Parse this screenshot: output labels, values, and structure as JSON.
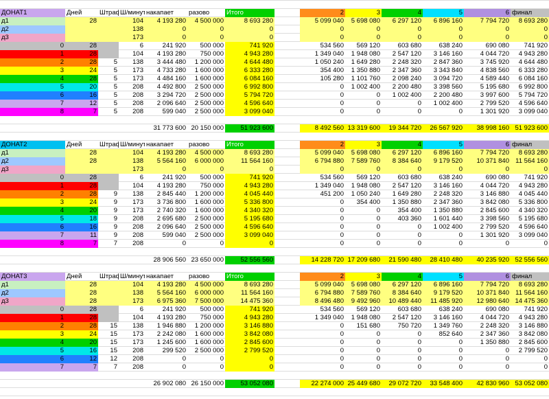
{
  "colors": {
    "lav": "#c9a6ee",
    "cyan": "#00c0f0",
    "lgreen": "#c8f0c0",
    "lblue": "#9ec8ff",
    "pink": "#f0a6c8",
    "ylw": "#ffff80",
    "gray": "#c0c0c0",
    "red": "#ff0000",
    "orange": "#ff8000",
    "yel": "#ffff00",
    "green": "#00d000",
    "cyn": "#00e8e8",
    "blue": "#2080ff",
    "mag": "#ff00ff",
    "total": "#ffff00",
    "itogo": "#00d000",
    "h2": "#ff8c1a",
    "h3": "#ffff00",
    "h4": "#00d000",
    "h5": "#00e0ff",
    "h6": "#b090e0",
    "hfin": "#c0c0c0"
  },
  "blocks": [
    {
      "header": [
        "ДОНАТ1",
        "Дней",
        "Штраф",
        "Ш/минут",
        "накапает",
        "разово",
        "Итого"
      ],
      "d_rows": [
        {
          "label": "д1",
          "days": "28",
          "fine": "",
          "sh": "104",
          "nak": "4 193 280",
          "raz": "4 500 000",
          "itogo": "8 693 280",
          "vals": [
            "5 099 040",
            "5 698 080",
            "6 297 120",
            "6 896 160",
            "7 794 720",
            "8 693 280"
          ]
        },
        {
          "label": "д2",
          "days": "",
          "fine": "",
          "sh": "138",
          "nak": "0",
          "raz": "0",
          "itogo": "0",
          "vals": [
            "0",
            "0",
            "0",
            "0",
            "0",
            "0"
          ]
        },
        {
          "label": "д3",
          "days": "",
          "fine": "",
          "sh": "173",
          "nak": "0",
          "raz": "0",
          "itogo": "0",
          "vals": [
            "0",
            "0",
            "0",
            "0",
            "0",
            "0"
          ]
        }
      ],
      "n_rows": [
        {
          "num": "0",
          "days": "28",
          "fine": "",
          "sh": "6",
          "nak": "241 920",
          "raz": "500 000",
          "itogo": "741 920",
          "vals": [
            "534 560",
            "569 120",
            "603 680",
            "638 240",
            "690 080",
            "741 920"
          ]
        },
        {
          "num": "1",
          "days": "28",
          "fine": "",
          "sh": "104",
          "nak": "4 193 280",
          "raz": "750 000",
          "itogo": "4 943 280",
          "vals": [
            "1 349 040",
            "1 948 080",
            "2 547 120",
            "3 146 160",
            "4 044 720",
            "4 943 280"
          ]
        },
        {
          "num": "2",
          "days": "28",
          "fine": "5",
          "sh": "138",
          "nak": "3 444 480",
          "raz": "1 200 000",
          "itogo": "4 644 480",
          "vals": [
            "1 050 240",
            "1 649 280",
            "2 248 320",
            "2 847 360",
            "3 745 920",
            "4 644 480"
          ]
        },
        {
          "num": "3",
          "days": "24",
          "fine": "5",
          "sh": "173",
          "nak": "4 733 280",
          "raz": "1 600 000",
          "itogo": "6 333 280",
          "vals": [
            "354 400",
            "1 350 880",
            "2 347 360",
            "3 343 840",
            "4 838 560",
            "6 333 280"
          ]
        },
        {
          "num": "4",
          "days": "28",
          "fine": "5",
          "sh": "173",
          "nak": "4 484 160",
          "raz": "1 600 000",
          "itogo": "6 084 160",
          "vals": [
            "105 280",
            "1 101 760",
            "2 098 240",
            "3 094 720",
            "4 589 440",
            "6 084 160"
          ]
        },
        {
          "num": "5",
          "days": "20",
          "fine": "5",
          "sh": "208",
          "nak": "4 492 800",
          "raz": "2 500 000",
          "itogo": "6 992 800",
          "vals": [
            "0",
            "1 002 400",
            "2 200 480",
            "3 398 560",
            "5 195 680",
            "6 992 800"
          ]
        },
        {
          "num": "6",
          "days": "16",
          "fine": "5",
          "sh": "208",
          "nak": "3 294 720",
          "raz": "2 500 000",
          "itogo": "5 794 720",
          "vals": [
            "0",
            "0",
            "1 002 400",
            "2 200 480",
            "3 997 600",
            "5 794 720"
          ]
        },
        {
          "num": "7",
          "days": "12",
          "fine": "5",
          "sh": "208",
          "nak": "2 096 640",
          "raz": "2 500 000",
          "itogo": "4 596 640",
          "vals": [
            "0",
            "0",
            "0",
            "1 002 400",
            "2 799 520",
            "4 596 640"
          ]
        },
        {
          "num": "8",
          "days": "7",
          "fine": "5",
          "sh": "208",
          "nak": "599 040",
          "raz": "2 500 000",
          "itogo": "3 099 040",
          "vals": [
            "0",
            "0",
            "0",
            "0",
            "1 301 920",
            "3 099 040"
          ]
        }
      ],
      "totals": {
        "nak": "31 773 600",
        "raz": "20 150 000",
        "itogo": "51 923 600",
        "vals": [
          "8 492 560",
          "13 319 600",
          "19 344 720",
          "26 567 920",
          "38 998 160",
          "51 923 600"
        ]
      }
    },
    {
      "header": [
        "ДОНАТ2",
        "Дней",
        "Штраф",
        "Ш/минут",
        "накапает",
        "разово",
        "Итого"
      ],
      "d_rows": [
        {
          "label": "д1",
          "days": "28",
          "fine": "",
          "sh": "104",
          "nak": "4 193 280",
          "raz": "4 500 000",
          "itogo": "8 693 280",
          "vals": [
            "5 099 040",
            "5 698 080",
            "6 297 120",
            "6 896 160",
            "7 794 720",
            "8 693 280"
          ]
        },
        {
          "label": "д2",
          "days": "28",
          "fine": "",
          "sh": "138",
          "nak": "5 564 160",
          "raz": "6 000 000",
          "itogo": "11 564 160",
          "vals": [
            "6 794 880",
            "7 589 760",
            "8 384 640",
            "9 179 520",
            "10 371 840",
            "11 564 160"
          ]
        },
        {
          "label": "д3",
          "days": "",
          "fine": "",
          "sh": "173",
          "nak": "0",
          "raz": "0",
          "itogo": "0",
          "vals": [
            "0",
            "0",
            "0",
            "0",
            "0",
            "0"
          ]
        }
      ],
      "n_rows": [
        {
          "num": "0",
          "days": "28",
          "fine": "",
          "sh": "6",
          "nak": "241 920",
          "raz": "500 000",
          "itogo": "741 920",
          "vals": [
            "534 560",
            "569 120",
            "603 680",
            "638 240",
            "690 080",
            "741 920"
          ]
        },
        {
          "num": "1",
          "days": "28",
          "fine": "",
          "sh": "104",
          "nak": "4 193 280",
          "raz": "750 000",
          "itogo": "4 943 280",
          "vals": [
            "1 349 040",
            "1 948 080",
            "2 547 120",
            "3 146 160",
            "4 044 720",
            "4 943 280"
          ]
        },
        {
          "num": "2",
          "days": "28",
          "fine": "9",
          "sh": "138",
          "nak": "2 845 440",
          "raz": "1 200 000",
          "itogo": "4 045 440",
          "vals": [
            "451 200",
            "1 050 240",
            "1 649 280",
            "2 248 320",
            "3 146 880",
            "4 045 440"
          ]
        },
        {
          "num": "3",
          "days": "24",
          "fine": "9",
          "sh": "173",
          "nak": "3 736 800",
          "raz": "1 600 000",
          "itogo": "5 336 800",
          "vals": [
            "0",
            "354 400",
            "1 350 880",
            "2 347 360",
            "3 842 080",
            "5 336 800"
          ]
        },
        {
          "num": "4",
          "days": "20",
          "fine": "9",
          "sh": "173",
          "nak": "2 740 320",
          "raz": "1 600 000",
          "itogo": "4 340 320",
          "vals": [
            "0",
            "0",
            "354 400",
            "1 350 880",
            "2 845 600",
            "4 340 320"
          ]
        },
        {
          "num": "5",
          "days": "18",
          "fine": "9",
          "sh": "208",
          "nak": "2 695 680",
          "raz": "2 500 000",
          "itogo": "5 195 680",
          "vals": [
            "0",
            "0",
            "403 360",
            "1 601 440",
            "3 398 560",
            "5 195 680"
          ]
        },
        {
          "num": "6",
          "days": "16",
          "fine": "9",
          "sh": "208",
          "nak": "2 096 640",
          "raz": "2 500 000",
          "itogo": "4 596 640",
          "vals": [
            "0",
            "0",
            "0",
            "1 002 400",
            "2 799 520",
            "4 596 640"
          ]
        },
        {
          "num": "7",
          "days": "11",
          "fine": "9",
          "sh": "208",
          "nak": "599 040",
          "raz": "2 500 000",
          "itogo": "3 099 040",
          "vals": [
            "0",
            "0",
            "0",
            "0",
            "1 301 920",
            "3 099 040"
          ]
        },
        {
          "num": "8",
          "days": "7",
          "fine": "7",
          "sh": "208",
          "nak": "0",
          "raz": "0",
          "itogo": "0",
          "vals": [
            "0",
            "0",
            "0",
            "0",
            "0",
            "0"
          ]
        }
      ],
      "totals": {
        "nak": "28 906 560",
        "raz": "23 650 000",
        "itogo": "52 556 560",
        "vals": [
          "14 228 720",
          "17 209 680",
          "21 590 480",
          "28 410 480",
          "40 235 920",
          "52 556 560"
        ]
      }
    },
    {
      "header": [
        "ДОНАТ3",
        "Дней",
        "Штраф",
        "Ш/минут",
        "накапает",
        "разово",
        "Итого"
      ],
      "d_rows": [
        {
          "label": "д1",
          "days": "28",
          "fine": "",
          "sh": "104",
          "nak": "4 193 280",
          "raz": "4 500 000",
          "itogo": "8 693 280",
          "vals": [
            "5 099 040",
            "5 698 080",
            "6 297 120",
            "6 896 160",
            "7 794 720",
            "8 693 280"
          ]
        },
        {
          "label": "д2",
          "days": "28",
          "fine": "",
          "sh": "138",
          "nak": "5 564 160",
          "raz": "6 000 000",
          "itogo": "11 564 160",
          "vals": [
            "6 794 880",
            "7 589 760",
            "8 384 640",
            "9 179 520",
            "10 371 840",
            "11 564 160"
          ]
        },
        {
          "label": "д3",
          "days": "28",
          "fine": "",
          "sh": "173",
          "nak": "6 975 360",
          "raz": "7 500 000",
          "itogo": "14 475 360",
          "vals": [
            "8 496 480",
            "9 492 960",
            "10 489 440",
            "11 485 920",
            "12 980 640",
            "14 475 360"
          ]
        }
      ],
      "n_rows": [
        {
          "num": "0",
          "days": "28",
          "fine": "",
          "sh": "6",
          "nak": "241 920",
          "raz": "500 000",
          "itogo": "741 920",
          "vals": [
            "534 560",
            "569 120",
            "603 680",
            "638 240",
            "690 080",
            "741 920"
          ]
        },
        {
          "num": "1",
          "days": "28",
          "fine": "",
          "sh": "104",
          "nak": "4 193 280",
          "raz": "750 000",
          "itogo": "4 943 280",
          "vals": [
            "1 349 040",
            "1 948 080",
            "2 547 120",
            "3 146 160",
            "4 044 720",
            "4 943 280"
          ]
        },
        {
          "num": "2",
          "days": "28",
          "fine": "15",
          "sh": "138",
          "nak": "1 946 880",
          "raz": "1 200 000",
          "itogo": "3 146 880",
          "vals": [
            "0",
            "151 680",
            "750 720",
            "1 349 760",
            "2 248 320",
            "3 146 880"
          ]
        },
        {
          "num": "3",
          "days": "24",
          "fine": "15",
          "sh": "173",
          "nak": "2 242 080",
          "raz": "1 600 000",
          "itogo": "3 842 080",
          "vals": [
            "0",
            "0",
            "0",
            "852 640",
            "2 347 360",
            "3 842 080"
          ]
        },
        {
          "num": "4",
          "days": "20",
          "fine": "15",
          "sh": "173",
          "nak": "1 245 600",
          "raz": "1 600 000",
          "itogo": "2 845 600",
          "vals": [
            "0",
            "0",
            "0",
            "0",
            "1 350 880",
            "2 845 600"
          ]
        },
        {
          "num": "5",
          "days": "16",
          "fine": "15",
          "sh": "208",
          "nak": "299 520",
          "raz": "2 500 000",
          "itogo": "2 799 520",
          "vals": [
            "0",
            "0",
            "0",
            "0",
            "0",
            "2 799 520"
          ]
        },
        {
          "num": "6",
          "days": "12",
          "fine": "12",
          "sh": "208",
          "nak": "0",
          "raz": "0",
          "itogo": "0",
          "vals": [
            "0",
            "0",
            "0",
            "0",
            "0",
            "0"
          ]
        },
        {
          "num": "7",
          "days": "7",
          "fine": "7",
          "sh": "208",
          "nak": "0",
          "raz": "0",
          "itogo": "0",
          "vals": [
            "0",
            "0",
            "0",
            "0",
            "0",
            "0"
          ]
        }
      ],
      "totals": {
        "nak": "26 902 080",
        "raz": "26 150 000",
        "itogo": "53 052 080",
        "vals": [
          "22 274 000",
          "25 449 680",
          "29 072 720",
          "33 548 400",
          "42 830 960",
          "53 052 080"
        ]
      }
    }
  ],
  "stage_headers": [
    "2",
    "3",
    "4",
    "5",
    "6",
    "финал"
  ]
}
